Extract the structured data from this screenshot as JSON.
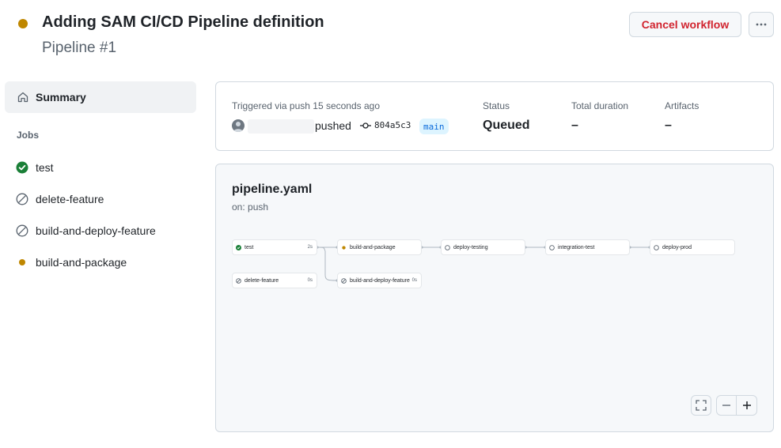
{
  "header": {
    "status_color": "#bf8700",
    "title": "Adding SAM CI/CD Pipeline definition",
    "subtitle": "Pipeline #1",
    "cancel_label": "Cancel workflow",
    "more_icon": "kebab-horizontal-icon"
  },
  "sidebar": {
    "summary_label": "Summary",
    "summary_icon": "home-icon",
    "jobs_heading": "Jobs",
    "jobs": [
      {
        "label": "test",
        "status": "success",
        "icon": "check-circle-icon"
      },
      {
        "label": "delete-feature",
        "status": "skipped",
        "icon": "skip-icon"
      },
      {
        "label": "build-and-deploy-feature",
        "status": "skipped",
        "icon": "skip-icon"
      },
      {
        "label": "build-and-package",
        "status": "queued",
        "icon": "queued-dot-icon"
      }
    ]
  },
  "run_info": {
    "trigger_text": "Triggered via push 15 seconds ago",
    "pushed_text": "pushed",
    "commit_sha": "804a5c3",
    "branch": "main",
    "status_label": "Status",
    "status_value": "Queued",
    "duration_label": "Total duration",
    "duration_value": "–",
    "artifacts_label": "Artifacts",
    "artifacts_value": "–"
  },
  "workflow": {
    "file": "pipeline.yaml",
    "trigger": "on: push",
    "nodes": [
      {
        "label": "test",
        "duration": "2s",
        "status": "success"
      },
      {
        "label": "build-and-package",
        "duration": "",
        "status": "queued"
      },
      {
        "label": "deploy-testing",
        "duration": "",
        "status": "pending"
      },
      {
        "label": "integration-test",
        "duration": "",
        "status": "pending"
      },
      {
        "label": "deploy-prod",
        "duration": "",
        "status": "pending"
      },
      {
        "label": "delete-feature",
        "duration": "0s",
        "status": "skipped"
      },
      {
        "label": "build-and-deploy-feature",
        "duration": "0s",
        "status": "skipped"
      }
    ],
    "controls": {
      "fullscreen_icon": "screen-full-icon",
      "zoom_out_icon": "minus-icon",
      "zoom_in_icon": "plus-icon"
    }
  },
  "colors": {
    "success": "#1a7f37",
    "queued": "#bf8700",
    "danger": "#d1242f",
    "link": "#0969da",
    "muted": "#59636e"
  }
}
